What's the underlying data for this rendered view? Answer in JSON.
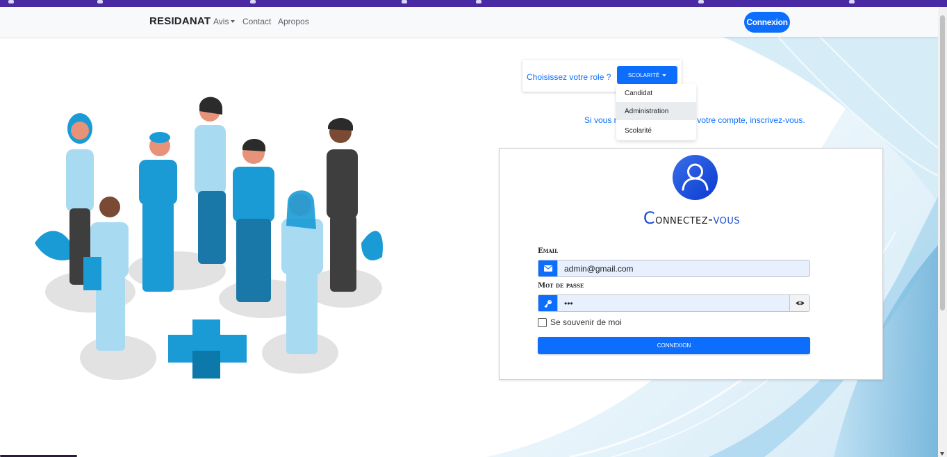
{
  "navbar": {
    "brand": "RESIDANAT",
    "links": {
      "avis": "Avis",
      "contact": "Contact",
      "apropos": "Apropos"
    },
    "login_button": "Connexion"
  },
  "role_selector": {
    "label": "Choisissez votre role ?",
    "selected": "Scolarité",
    "options": [
      "Candidat",
      "Administration",
      "Scolarité"
    ],
    "hovered_option": "Administration"
  },
  "signup": {
    "text_start": "Si vous n",
    "text_end": "votre compte, inscrivez-vous."
  },
  "login_card": {
    "title_first": "C",
    "title_mid": "onnectez-",
    "title_end": "vous",
    "email_label": "Email",
    "email_value": "admin@gmail.com",
    "password_label": "Mot de passe",
    "password_value": "•••",
    "remember_label": "Se souvenir de moi",
    "remember_checked": false,
    "submit_label": "Connexion"
  },
  "icons": {
    "email": "envelope-icon",
    "password": "key-icon",
    "toggle": "eye-icon",
    "avatar": "user-icon"
  },
  "colors": {
    "accent": "#0d6efd",
    "browser_bar": "#4a2aa4"
  }
}
